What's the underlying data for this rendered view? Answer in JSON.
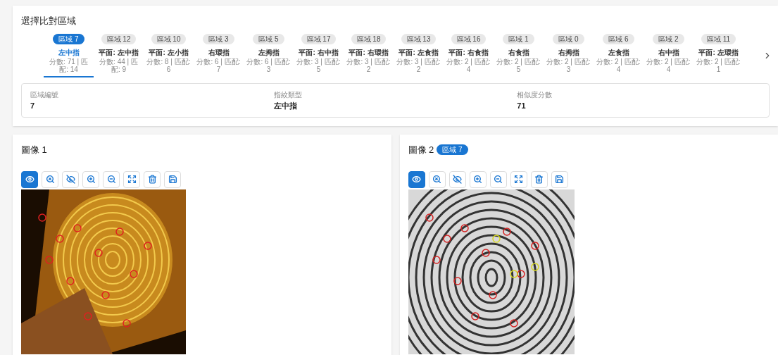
{
  "region_selector": {
    "title": "選擇比對區域",
    "tabs": [
      {
        "region": "區域 7",
        "finger": "左中指",
        "stats": "分數: 71 | 匹配: 14",
        "selected": true
      },
      {
        "region": "區域 12",
        "finger": "平面: 左中指",
        "stats": "分數: 44 | 匹配: 9",
        "selected": false
      },
      {
        "region": "區域 10",
        "finger": "平面: 左小指",
        "stats": "分數: 8 | 匹配: 6",
        "selected": false
      },
      {
        "region": "區域 3",
        "finger": "右環指",
        "stats": "分數: 6 | 匹配: 7",
        "selected": false
      },
      {
        "region": "區域 5",
        "finger": "左拇指",
        "stats": "分數: 6 | 匹配: 3",
        "selected": false
      },
      {
        "region": "區域 17",
        "finger": "平面: 右中指",
        "stats": "分數: 3 | 匹配: 5",
        "selected": false
      },
      {
        "region": "區域 18",
        "finger": "平面: 右環指",
        "stats": "分數: 3 | 匹配: 2",
        "selected": false
      },
      {
        "region": "區域 13",
        "finger": "平面: 左食指",
        "stats": "分數: 3 | 匹配: 2",
        "selected": false
      },
      {
        "region": "區域 16",
        "finger": "平面: 右食指",
        "stats": "分數: 2 | 匹配: 4",
        "selected": false
      },
      {
        "region": "區域 1",
        "finger": "右食指",
        "stats": "分數: 2 | 匹配: 5",
        "selected": false
      },
      {
        "region": "區域 0",
        "finger": "右拇指",
        "stats": "分數: 2 | 匹配: 3",
        "selected": false
      },
      {
        "region": "區域 6",
        "finger": "左食指",
        "stats": "分數: 2 | 匹配: 4",
        "selected": false
      },
      {
        "region": "區域 2",
        "finger": "右中指",
        "stats": "分數: 2 | 匹配: 4",
        "selected": false
      },
      {
        "region": "區域 11",
        "finger": "平面: 左環指",
        "stats": "分數: 2 | 匹配: 1",
        "selected": false
      }
    ],
    "details": [
      {
        "label": "區域編號",
        "value": "7"
      },
      {
        "label": "指紋類型",
        "value": "左中指"
      },
      {
        "label": "相似度分數",
        "value": "71"
      }
    ]
  },
  "images": [
    {
      "title": "圖像 1",
      "kind": "latent",
      "tools": [
        {
          "kind": "view",
          "selected": true
        },
        {
          "kind": "reset-zoom",
          "selected": false
        },
        {
          "kind": "hide",
          "selected": false
        },
        {
          "kind": "zoom-in",
          "selected": false
        },
        {
          "kind": "zoom-out",
          "selected": false
        },
        {
          "kind": "fit",
          "selected": false
        },
        {
          "kind": "delete",
          "selected": false
        },
        {
          "kind": "save",
          "selected": false
        }
      ]
    },
    {
      "title": "圖像 2",
      "badge": "區域 7",
      "kind": "rolled",
      "tools": [
        {
          "kind": "view",
          "selected": true
        },
        {
          "kind": "reset-zoom",
          "selected": false
        },
        {
          "kind": "hide",
          "selected": false
        },
        {
          "kind": "zoom-in",
          "selected": false
        },
        {
          "kind": "zoom-out",
          "selected": false
        },
        {
          "kind": "fit",
          "selected": false
        },
        {
          "kind": "delete",
          "selected": false
        },
        {
          "kind": "save",
          "selected": false
        }
      ]
    }
  ]
}
